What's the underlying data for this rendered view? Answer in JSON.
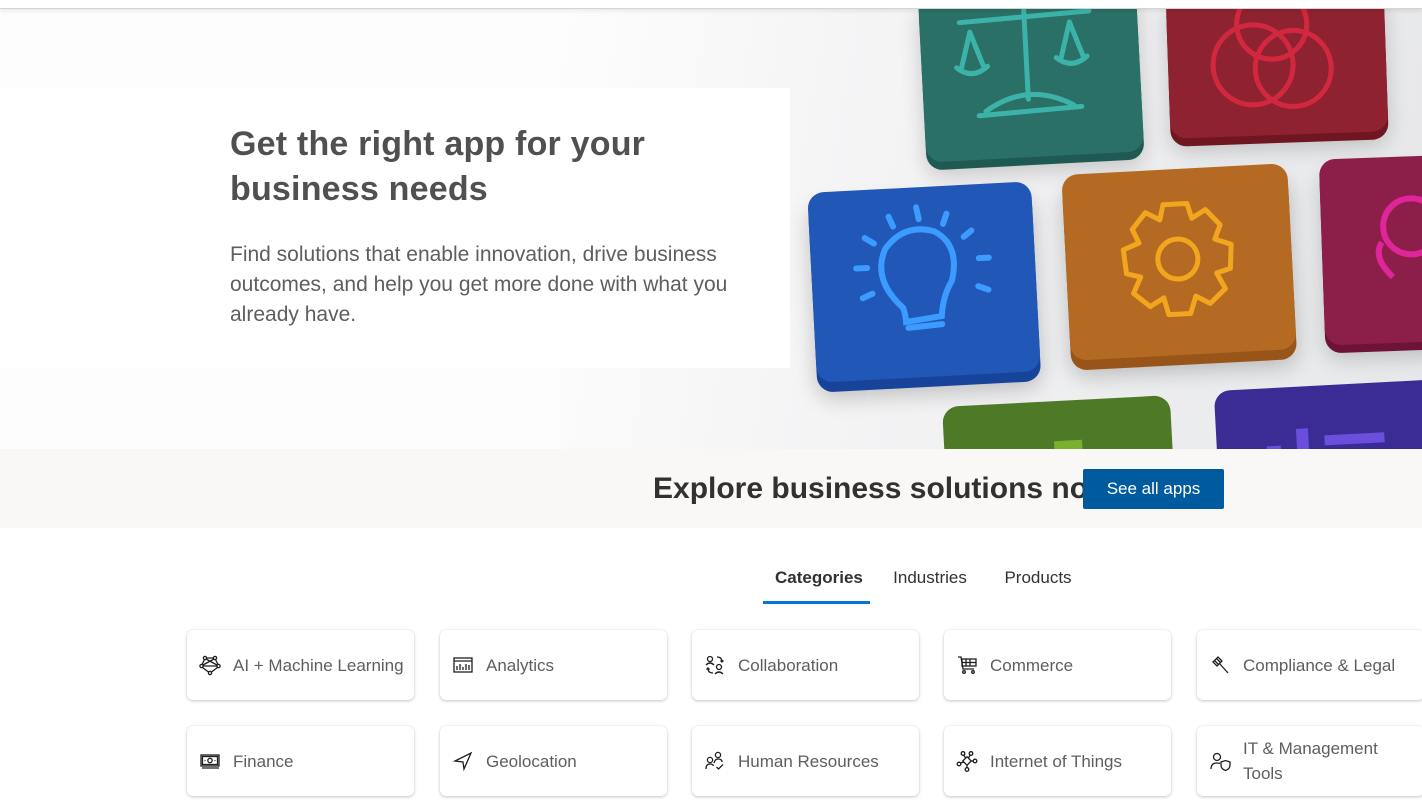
{
  "hero": {
    "title": "Get the right app for your business needs",
    "subtitle": "Find solutions that enable innovation, drive business outcomes, and help you get more done with what you already have.",
    "image_tiles": [
      {
        "icon": "scales-icon",
        "color": "#2a7066"
      },
      {
        "icon": "currency-icon",
        "color": "#8e2230"
      },
      {
        "icon": "lightbulb-icon",
        "color": "#2157b6"
      },
      {
        "icon": "gear-icon",
        "color": "#b46a22"
      },
      {
        "icon": "person-icon",
        "color": "#8c1f4a"
      },
      {
        "icon": "plant-icon",
        "color": "#4e7a28"
      },
      {
        "icon": "chart-icon",
        "color": "#3a2c94"
      }
    ]
  },
  "explore": {
    "title": "Explore business solutions now",
    "button_label": "See all apps",
    "button_color": "#005a9e"
  },
  "tabs": [
    {
      "label": "Categories",
      "active": true
    },
    {
      "label": "Industries",
      "active": false
    },
    {
      "label": "Products",
      "active": false
    }
  ],
  "accent_color": "#0078d4",
  "categories": [
    {
      "label": "AI + Machine Learning",
      "icon": "neural-network-icon"
    },
    {
      "label": "Analytics",
      "icon": "analytics-chart-icon"
    },
    {
      "label": "Collaboration",
      "icon": "collaboration-icon"
    },
    {
      "label": "Commerce",
      "icon": "shopping-cart-icon"
    },
    {
      "label": "Compliance & Legal",
      "icon": "gavel-icon"
    },
    {
      "label": "Finance",
      "icon": "money-icon"
    },
    {
      "label": "Geolocation",
      "icon": "navigation-arrow-icon"
    },
    {
      "label": "Human Resources",
      "icon": "people-check-icon"
    },
    {
      "label": "Internet of Things",
      "icon": "iot-hub-icon"
    },
    {
      "label": "IT & Management Tools",
      "icon": "person-shield-icon"
    }
  ]
}
